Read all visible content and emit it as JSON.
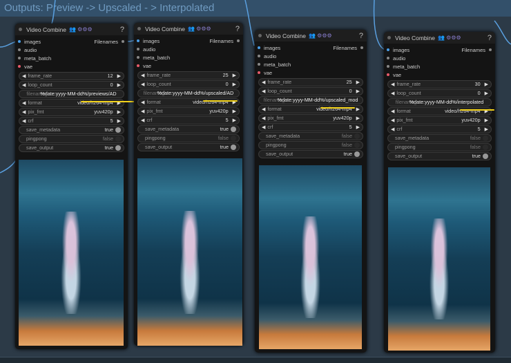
{
  "group_title": "Outputs: Preview -> Upscaled - > Interpolated",
  "nodes": [
    {
      "title": "Video Combine",
      "badge": "👥 ⚙⚙⚙",
      "help": "?",
      "inputs": [
        "images",
        "audio",
        "meta_batch",
        "vae"
      ],
      "output": "Filenames",
      "widgets": [
        {
          "type": "num",
          "label": "frame_rate",
          "value": "12"
        },
        {
          "type": "num",
          "label": "loop_count",
          "value": "0"
        },
        {
          "type": "text",
          "label": "filename_prefix",
          "value": "%date:yyyy-MM-dd%/previews/AD"
        },
        {
          "type": "num",
          "label": "format",
          "value": "video/h264-mp4"
        },
        {
          "type": "num",
          "label": "pix_fmt",
          "value": "yuv420p"
        },
        {
          "type": "num",
          "label": "crf",
          "value": "5"
        },
        {
          "type": "toggle",
          "label": "save_metadata",
          "value": "true"
        },
        {
          "type": "toggle",
          "label": "pingpong",
          "value": "false"
        },
        {
          "type": "toggle",
          "label": "save_output",
          "value": "true"
        }
      ]
    },
    {
      "title": "Video Combine",
      "badge": "👥 ⚙⚙⚙",
      "help": "?",
      "inputs": [
        "images",
        "audio",
        "meta_batch",
        "vae"
      ],
      "output": "Filenames",
      "widgets": [
        {
          "type": "num",
          "label": "frame_rate",
          "value": "25"
        },
        {
          "type": "num",
          "label": "loop_count",
          "value": "0"
        },
        {
          "type": "text",
          "label": "filename_prefix",
          "value": "%date:yyyy-MM-dd%/upscaled/AD"
        },
        {
          "type": "num",
          "label": "format",
          "value": "video/h264-mp4"
        },
        {
          "type": "num",
          "label": "pix_fmt",
          "value": "yuv420p"
        },
        {
          "type": "num",
          "label": "crf",
          "value": "5"
        },
        {
          "type": "toggle",
          "label": "save_metadata",
          "value": "true"
        },
        {
          "type": "toggle",
          "label": "pingpong",
          "value": "false"
        },
        {
          "type": "toggle",
          "label": "save_output",
          "value": "true"
        }
      ]
    },
    {
      "title": "Video Combine",
      "badge": "👥 ⚙⚙⚙",
      "help": "?",
      "inputs": [
        "images",
        "audio",
        "meta_batch",
        "vae"
      ],
      "output": "Filenames",
      "widgets": [
        {
          "type": "num",
          "label": "frame_rate",
          "value": "25"
        },
        {
          "type": "num",
          "label": "loop_count",
          "value": "0"
        },
        {
          "type": "text",
          "label": "filename_prefix",
          "value": "%date:yyyy-MM-dd%/upscaled_mod"
        },
        {
          "type": "num",
          "label": "format",
          "value": "video/h264-mp4"
        },
        {
          "type": "num",
          "label": "pix_fmt",
          "value": "yuv420p"
        },
        {
          "type": "num",
          "label": "crf",
          "value": "5"
        },
        {
          "type": "toggle",
          "label": "save_metadata",
          "value": "false"
        },
        {
          "type": "toggle",
          "label": "pingpong",
          "value": "false"
        },
        {
          "type": "toggle",
          "label": "save_output",
          "value": "true"
        }
      ]
    },
    {
      "title": "Video Combine",
      "badge": "👥 ⚙⚙⚙",
      "help": "?",
      "inputs": [
        "images",
        "audio",
        "meta_batch",
        "vae"
      ],
      "output": "Filenames",
      "widgets": [
        {
          "type": "num",
          "label": "frame_rate",
          "value": "30"
        },
        {
          "type": "num",
          "label": "loop_count",
          "value": "0"
        },
        {
          "type": "text",
          "label": "filename_prefix",
          "value": "%date:yyyy-MM-dd%/interpolated"
        },
        {
          "type": "num",
          "label": "format",
          "value": "video/h264-mp4"
        },
        {
          "type": "num",
          "label": "pix_fmt",
          "value": "yuv420p"
        },
        {
          "type": "num",
          "label": "crf",
          "value": "5"
        },
        {
          "type": "toggle",
          "label": "save_metadata",
          "value": "false"
        },
        {
          "type": "toggle",
          "label": "pingpong",
          "value": "false"
        },
        {
          "type": "toggle",
          "label": "save_output",
          "value": "true"
        }
      ]
    }
  ],
  "colors": {
    "input_images": "#4a9fe8",
    "input_vae": "#e85a6a",
    "highlight": "#f2d21a"
  }
}
